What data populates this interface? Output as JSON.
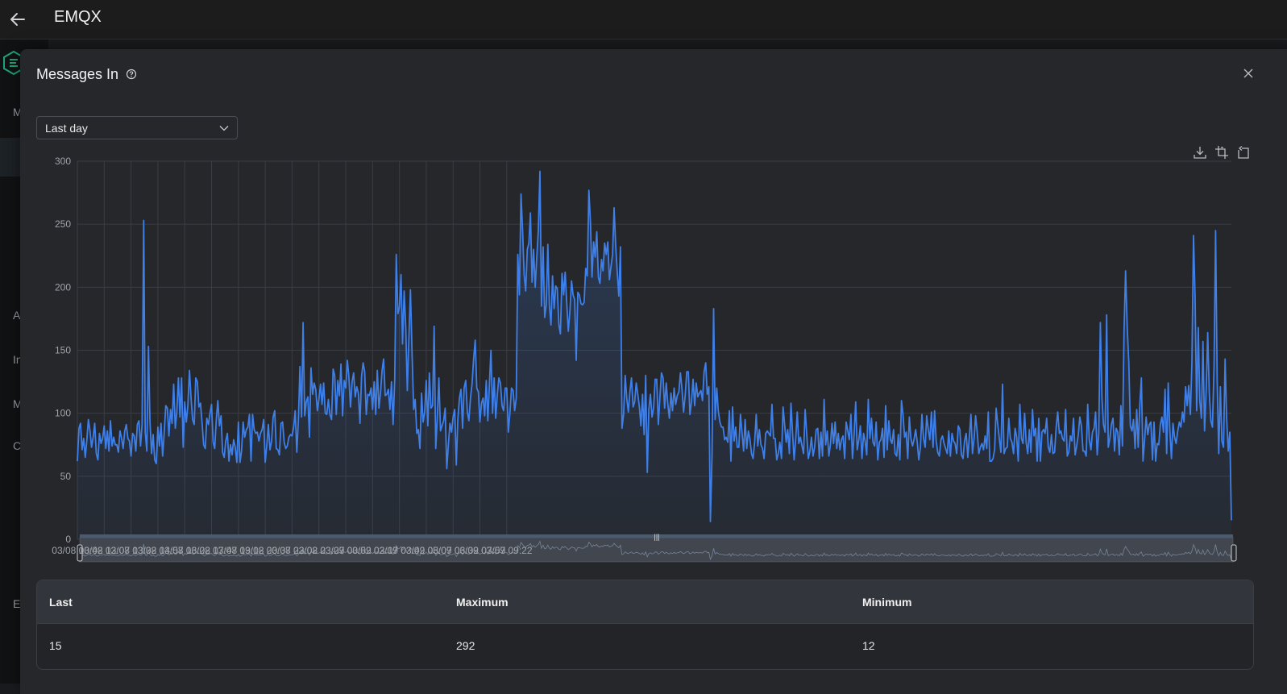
{
  "app": {
    "title": "EMQX"
  },
  "sidebar_background": {
    "letters": [
      "M",
      "A",
      "In",
      "M",
      "C",
      "E"
    ]
  },
  "modal": {
    "title": "Messages In",
    "range_select": {
      "value": "Last day"
    }
  },
  "chart_data": {
    "type": "area",
    "y_ticks": [
      0,
      50,
      100,
      150,
      200,
      250,
      300
    ],
    "ylim": [
      0,
      300
    ],
    "x_labels": [
      "03/08 10:42",
      "03/08 12:07",
      "03/08 13:32",
      "03/08 14:57",
      "03/08 16:22",
      "03/08 17:47",
      "03/08 19:12",
      "03/08 20:37",
      "03/08 22:02",
      "03/08 23:27",
      "03/09 00:52",
      "03/09 02:17",
      "03/09 03:42",
      "03/09 05:07",
      "03/09 06:32",
      "03/09 07:57",
      "03/09 09:22"
    ],
    "x_interval_minutes": 85,
    "sample_step_minutes": 5,
    "grid": true,
    "line_color": "#3f7fe8",
    "values": [
      62,
      88,
      92,
      71,
      80,
      65,
      79,
      95,
      86,
      73,
      81,
      92,
      68,
      63,
      84,
      76,
      80,
      90,
      72,
      86,
      70,
      94,
      74,
      81,
      75,
      75,
      69,
      86,
      80,
      72,
      86,
      91,
      80,
      78,
      66,
      84,
      82,
      70,
      91,
      94,
      74,
      91,
      253,
      85,
      70,
      153,
      93,
      68,
      83,
      63,
      60,
      89,
      74,
      92,
      66,
      84,
      106,
      104,
      82,
      103,
      92,
      123,
      88,
      101,
      128,
      97,
      128,
      73,
      109,
      93,
      106,
      134,
      113,
      95,
      91,
      128,
      125,
      105,
      108,
      92,
      75,
      72,
      96,
      91,
      100,
      107,
      77,
      72,
      95,
      110,
      90,
      98,
      69,
      65,
      78,
      84,
      62,
      75,
      67,
      79,
      73,
      61,
      93,
      61,
      70,
      93,
      81,
      87,
      89,
      99,
      62,
      99,
      87,
      84,
      85,
      78,
      84,
      87,
      95,
      61,
      75,
      91,
      71,
      78,
      97,
      102,
      72,
      71,
      67,
      92,
      93,
      77,
      72,
      74,
      81,
      83,
      82,
      89,
      102,
      69,
      95,
      137,
      97,
      172,
      98,
      109,
      113,
      81,
      136,
      115,
      124,
      119,
      102,
      111,
      123,
      107,
      124,
      100,
      99,
      111,
      99,
      95,
      135,
      130,
      99,
      126,
      114,
      139,
      98,
      126,
      120,
      142,
      129,
      105,
      125,
      132,
      113,
      121,
      116,
      92,
      129,
      140,
      133,
      99,
      115,
      114,
      120,
      103,
      125,
      99,
      134,
      104,
      116,
      134,
      143,
      114,
      115,
      119,
      103,
      125,
      91,
      127,
      226,
      179,
      184,
      210,
      155,
      197,
      168,
      118,
      160,
      198,
      148,
      103,
      111,
      84,
      87,
      72,
      116,
      93,
      101,
      126,
      90,
      132,
      104,
      106,
      169,
      72,
      96,
      128,
      86,
      90,
      94,
      104,
      56,
      75,
      92,
      85,
      97,
      103,
      59,
      95,
      112,
      119,
      88,
      120,
      126,
      101,
      94,
      112,
      123,
      143,
      158,
      120,
      117,
      93,
      108,
      112,
      98,
      126,
      94,
      123,
      150,
      100,
      128,
      96,
      115,
      128,
      124,
      106,
      102,
      120,
      120,
      85,
      101,
      120,
      118,
      102,
      112,
      226,
      194,
      274,
      246,
      210,
      197,
      230,
      235,
      259,
      204,
      230,
      200,
      224,
      245,
      292,
      185,
      232,
      176,
      186,
      234,
      186,
      170,
      209,
      183,
      201,
      199,
      170,
      163,
      211,
      194,
      212,
      187,
      165,
      181,
      205,
      194,
      190,
      142,
      196,
      194,
      187,
      186,
      188,
      215,
      209,
      277,
      251,
      208,
      236,
      224,
      244,
      208,
      203,
      222,
      213,
      235,
      226,
      236,
      206,
      216,
      226,
      263,
      233,
      211,
      193,
      232,
      88,
      99,
      130,
      112,
      101,
      117,
      128,
      105,
      109,
      124,
      115,
      105,
      90,
      115,
      83,
      130,
      53,
      103,
      115,
      97,
      104,
      127,
      127,
      91,
      113,
      132,
      128,
      104,
      124,
      107,
      96,
      116,
      102,
      120,
      107,
      114,
      117,
      132,
      119,
      101,
      114,
      133,
      133,
      99,
      109,
      127,
      106,
      124,
      113,
      116,
      118,
      110,
      133,
      140,
      115,
      121,
      14,
      66,
      183,
      95,
      120,
      102,
      93,
      89,
      89,
      79,
      81,
      77,
      102,
      62,
      105,
      78,
      89,
      73,
      73,
      99,
      85,
      70,
      95,
      72,
      86,
      80,
      68,
      64,
      77,
      99,
      74,
      87,
      75,
      72,
      64,
      84,
      86,
      84,
      82,
      107,
      80,
      80,
      63,
      68,
      77,
      64,
      105,
      91,
      77,
      87,
      68,
      108,
      85,
      63,
      79,
      101,
      76,
      81,
      74,
      68,
      103,
      84,
      64,
      70,
      81,
      66,
      73,
      87,
      88,
      64,
      85,
      66,
      111,
      75,
      86,
      66,
      75,
      92,
      76,
      93,
      72,
      84,
      71,
      79,
      82,
      64,
      93,
      86,
      79,
      99,
      64,
      83,
      109,
      71,
      79,
      90,
      64,
      84,
      78,
      67,
      111,
      80,
      96,
      77,
      74,
      93,
      63,
      77,
      79,
      88,
      65,
      106,
      71,
      94,
      79,
      76,
      87,
      68,
      66,
      83,
      63,
      110,
      99,
      81,
      85,
      64,
      97,
      80,
      74,
      79,
      87,
      77,
      63,
      73,
      99,
      80,
      73,
      98,
      87,
      79,
      101,
      73,
      102,
      78,
      69,
      66,
      79,
      82,
      76,
      72,
      68,
      86,
      66,
      84,
      78,
      76,
      68,
      90,
      87,
      67,
      64,
      78,
      84,
      65,
      81,
      99,
      68,
      80,
      98,
      85,
      68,
      73,
      76,
      71,
      82,
      72,
      101,
      62,
      62,
      64,
      71,
      104,
      91,
      80,
      69,
      123,
      68,
      72,
      73,
      96,
      80,
      77,
      68,
      88,
      81,
      62,
      107,
      80,
      76,
      100,
      77,
      68,
      87,
      69,
      103,
      82,
      88,
      62,
      96,
      62,
      85,
      87,
      84,
      96,
      73,
      69,
      83,
      68,
      69,
      89,
      101,
      84,
      86,
      80,
      78,
      103,
      66,
      69,
      82,
      78,
      96,
      67,
      74,
      83,
      97,
      90,
      70,
      70,
      66,
      107,
      79,
      71,
      85,
      88,
      101,
      67,
      84,
      172,
      112,
      91,
      85,
      178,
      73,
      80,
      91,
      96,
      70,
      88,
      85,
      67,
      106,
      74,
      166,
      213,
      169,
      140,
      90,
      86,
      95,
      72,
      103,
      73,
      107,
      128,
      62,
      79,
      97,
      83,
      91,
      93,
      63,
      93,
      62,
      76,
      75,
      91,
      97,
      85,
      119,
      68,
      124,
      87,
      64,
      92,
      81,
      76,
      86,
      93,
      89,
      101,
      93,
      121,
      106,
      122,
      99,
      140,
      241,
      193,
      102,
      168,
      110,
      96,
      157,
      86,
      118,
      164,
      116,
      94,
      89,
      138,
      245,
      125,
      68,
      121,
      78,
      73,
      143,
      96,
      70,
      85,
      15
    ]
  },
  "stats": {
    "headers": {
      "last": "Last",
      "maximum": "Maximum",
      "minimum": "Minimum"
    },
    "values": {
      "last": "15",
      "maximum": "292",
      "minimum": "12"
    }
  }
}
